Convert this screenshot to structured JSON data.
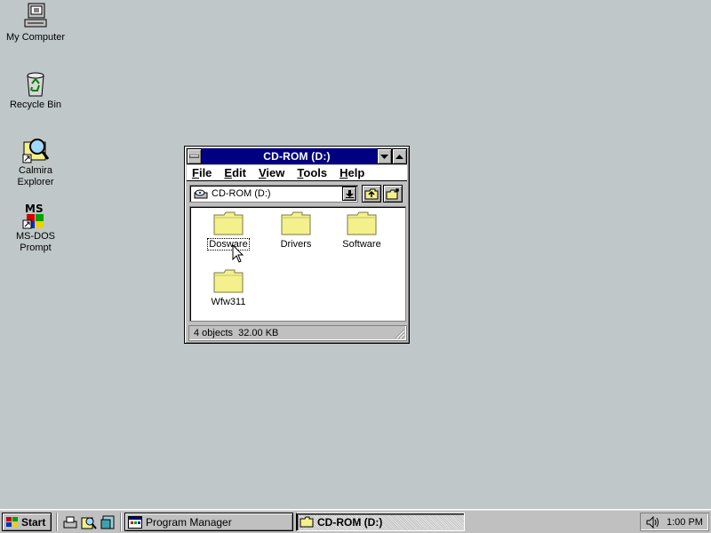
{
  "desktop": {
    "icons": [
      {
        "label": "My Computer",
        "icon": "my-computer-icon"
      },
      {
        "label": "Recycle Bin",
        "icon": "recycle-bin-icon"
      },
      {
        "label_line1": "Calmira",
        "label_line2": "Explorer",
        "icon": "calmira-explorer-icon"
      },
      {
        "label_line1": "MS-DOS",
        "label_line2": "Prompt",
        "icon": "ms-dos-icon"
      }
    ]
  },
  "window": {
    "title": "CD-ROM (D:)",
    "menu": [
      {
        "label": "File",
        "mnemonic": "F"
      },
      {
        "label": "Edit",
        "mnemonic": "E"
      },
      {
        "label": "View",
        "mnemonic": "V"
      },
      {
        "label": "Tools",
        "mnemonic": "T"
      },
      {
        "label": "Help",
        "mnemonic": "H"
      }
    ],
    "drive_select": {
      "value": "CD-ROM (D:)"
    },
    "folders": [
      {
        "name": "Dosware",
        "focused": true
      },
      {
        "name": "Drivers",
        "focused": false
      },
      {
        "name": "Software",
        "focused": false
      },
      {
        "name": "Wfw311",
        "focused": false
      }
    ],
    "status": "4 objects  32.00 KB"
  },
  "taskbar": {
    "start_label": "Start",
    "tasks": [
      {
        "label": "Program Manager",
        "active": false
      },
      {
        "label": "CD-ROM (D:)",
        "active": true
      }
    ],
    "clock": "1:00 PM"
  },
  "colors": {
    "desktop": "#c0c7c8",
    "titlebar": "#000080",
    "folder": "#f4f08c"
  }
}
